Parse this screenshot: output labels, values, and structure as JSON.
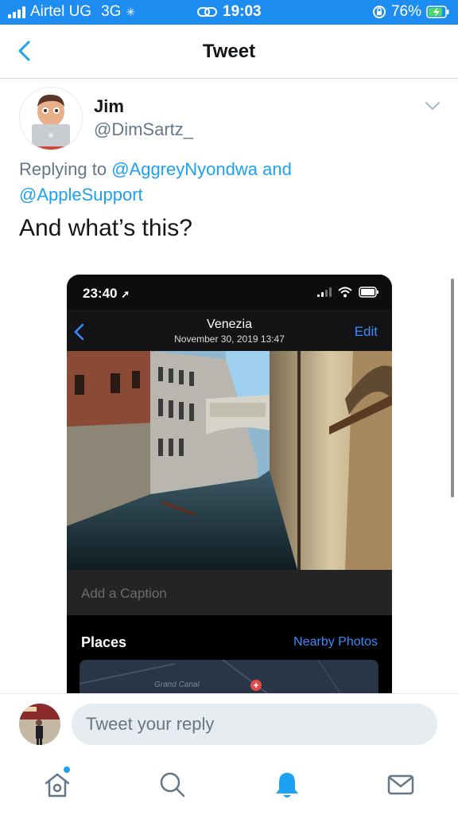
{
  "status_bar": {
    "carrier": "Airtel UG",
    "network": "3G",
    "time": "19:03",
    "battery": "76%",
    "bar_color": "#1d8df2"
  },
  "nav": {
    "title": "Tweet",
    "back_icon": "chevron-left-icon"
  },
  "tweet": {
    "author_name": "Jim",
    "author_handle": "@DimSartz_",
    "replying_prefix": "Replying to",
    "reply_to_1": "@AggreyNyondwa",
    "reply_joiner": "and",
    "reply_to_2": "@AppleSupport",
    "text": "And what’s this?"
  },
  "embedded_screenshot": {
    "time": "23:40",
    "location_title": "Venezia",
    "date": "November 30, 2019  13:47",
    "edit_label": "Edit",
    "caption_placeholder": "Add a Caption",
    "places_label": "Places",
    "nearby_label": "Nearby Photos",
    "map_label": "Grand Canal"
  },
  "reply_bar": {
    "placeholder": "Tweet your reply"
  },
  "tab_bar": {
    "items": [
      "home-icon",
      "search-icon",
      "notifications-icon",
      "messages-icon"
    ],
    "active": "notifications-icon"
  },
  "colors": {
    "accent": "#1da1f2",
    "secondary_text": "#657786"
  }
}
